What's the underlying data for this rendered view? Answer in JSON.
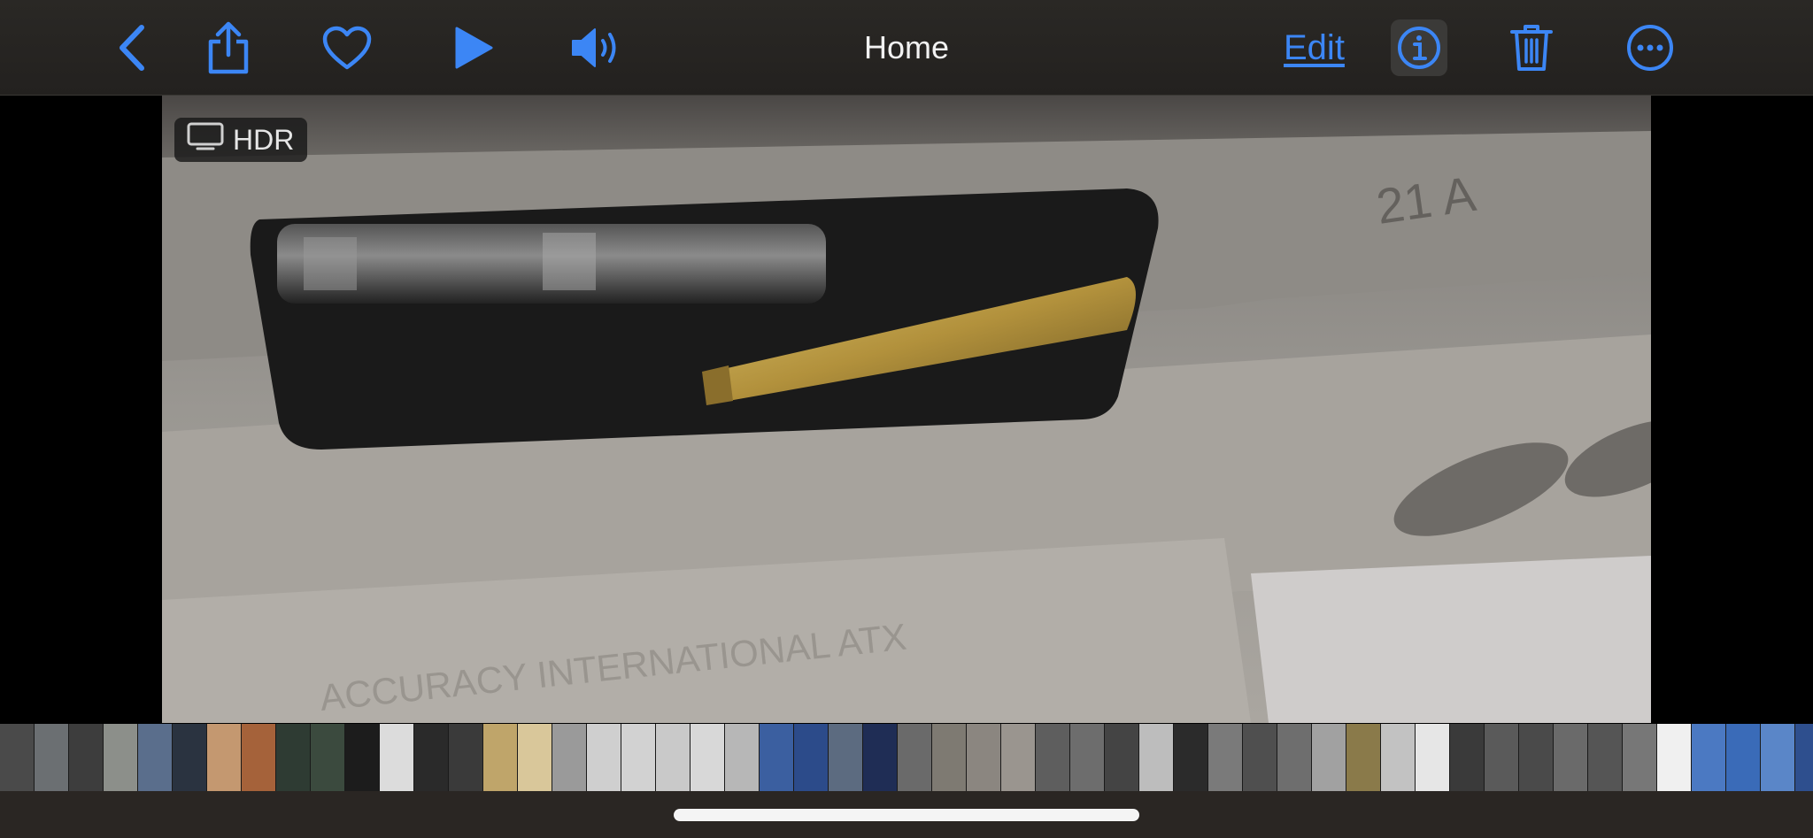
{
  "toolbar": {
    "title": "Home",
    "edit_label": "Edit",
    "icons": [
      "back-chevron-icon",
      "share-icon",
      "heart-icon",
      "play-icon",
      "speaker-icon",
      "info-icon",
      "trash-icon",
      "more-icon"
    ],
    "accent_color": "#3c86f5"
  },
  "photo": {
    "badge_label": "HDR",
    "badge_icon": "tv-icon"
  },
  "filmstrip": {
    "thumb_colors": [
      "#4a4a4a",
      "#6b6f72",
      "#3d3d3d",
      "#8c8f8a",
      "#5a6e8c",
      "#2a3340",
      "#c49870",
      "#a5623a",
      "#2e3b33",
      "#3b4a3e",
      "#1c1c1c",
      "#dcdcdc",
      "#2a2a2a",
      "#3a3a3a",
      "#bfa56a",
      "#d9c79a",
      "#9a9a9a",
      "#cfcfcf",
      "#d2d2d2",
      "#c9c9c9",
      "#d8d8d8",
      "#b7b7b7",
      "#3b5fa0",
      "#2c4b8a",
      "#5c6b80",
      "#1f2d55",
      "#6a6a6a",
      "#7e7a72",
      "#8b8680",
      "#9a958f",
      "#5e5e5e",
      "#6d6d6d",
      "#444444",
      "#bdbdbd",
      "#2b2b2b",
      "#7a7a7a",
      "#4f4f4f",
      "#6e6e6e",
      "#a1a1a1",
      "#8a7a4a",
      "#c2c2c2",
      "#e6e6e6",
      "#3a3a3a",
      "#5a5a5a",
      "#4a4a4a",
      "#6a6a6a",
      "#555555",
      "#777777",
      "#f0f0f0",
      "#4b79c2",
      "#3a6bb8",
      "#5a86c8",
      "#2e4f8e",
      "#3f5f90",
      "#6f8fbf",
      "#3b68a8",
      "#2d4d7e",
      "#5577aa",
      "#35558a"
    ]
  }
}
